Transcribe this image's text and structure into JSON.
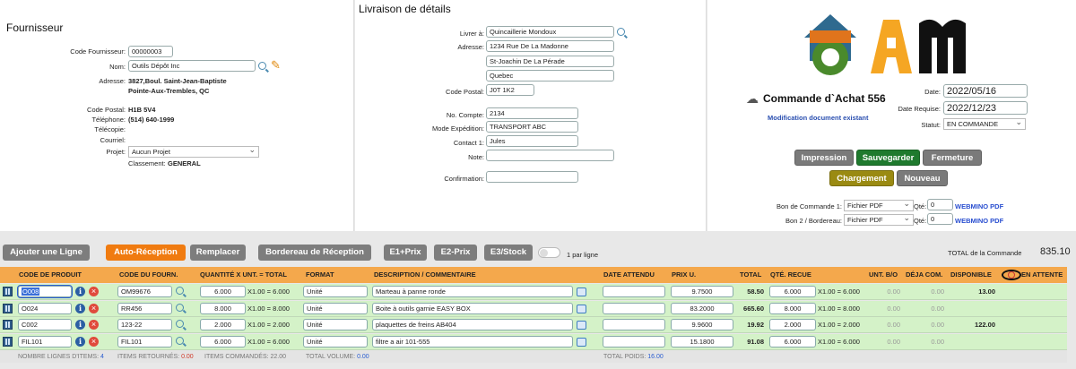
{
  "supplier": {
    "title": "Fournisseur",
    "code_label": "Code Fournisseur:",
    "code": "00000003",
    "name_label": "Nom:",
    "name": "Outils Dépôt Inc",
    "address_label": "Adresse:",
    "address1": "3827,Boul. Saint-Jean-Baptiste",
    "address2": "Pointe-Aux-Trembles, QC",
    "postal_label": "Code Postal:",
    "postal": "H1B 5V4",
    "phone_label": "Téléphone:",
    "phone": "(514) 640-1999",
    "fax_label": "Télécopie:",
    "email_label": "Courriel:",
    "project_label": "Projet:",
    "project": "Aucun Projet",
    "class_label": "Classement:",
    "class": "GENERAL"
  },
  "delivery": {
    "title": "Livraison de détails",
    "deliver_label": "Livrer à:",
    "deliver": "Quincaillerie Mondoux",
    "address_label": "Adresse:",
    "address1": "1234 Rue De La Madonne",
    "address2": "St-Joachin De La Pérade",
    "address3": "Quebec",
    "postal_label": "Code Postal:",
    "postal": "J0T 1K2",
    "account_label": "No. Compte:",
    "account": "2134",
    "ship_label": "Mode Expédition:",
    "ship": "TRANSPORT ABC",
    "contact_label": "Contact 1:",
    "contact": "Jules",
    "note_label": "Note:",
    "note": "",
    "confirm_label": "Confirmation:",
    "confirm": ""
  },
  "order": {
    "title": "Commande d`Achat 556",
    "subtitle": "Modification document existant",
    "date_label": "Date:",
    "date": "2022/05/16",
    "req_label": "Date Requise:",
    "req": "2022/12/23",
    "status_label": "Statut:",
    "status": "EN COMMANDE"
  },
  "actions": {
    "print": "Impression",
    "save": "Sauvegarder",
    "close": "Fermeture",
    "load": "Chargement",
    "new": "Nouveau"
  },
  "docs": {
    "bc1_label": "Bon de Commande 1:",
    "bc1_fmt": "Fichier PDF",
    "bc2_label": "Bon 2 / Bordereau:",
    "bc2_fmt": "Fichier PDF",
    "qty_label": "Qté:",
    "qty1": "0",
    "qty2": "0",
    "link": "WEBMINO PDF"
  },
  "toolbar": {
    "add": "Ajouter une Ligne",
    "auto": "Auto-Réception",
    "replace": "Remplacer",
    "slip": "Bordereau de Réception",
    "e1": "E1+Prix",
    "e2": "E2-Prix",
    "e3": "E3/Stock",
    "toggle_label": "1 par ligne",
    "total_label": "TOTAL de la Commande",
    "total": "835.10"
  },
  "headers": [
    "CODE DE PRODUIT",
    "CODE DU FOURN.",
    "QUANTITÉ X UNT. = TOTAL",
    "FORMAT",
    "DESCRIPTION / COMMENTAIRE",
    "DATE ATTENDU",
    "PRIX U.",
    "TOTAL",
    "QTÉ. RECUE",
    "UNT. B/O",
    "DÉJA COM.",
    "DISPONIBLE",
    "EN ATTENTE"
  ],
  "rows": [
    {
      "code": "O008",
      "fcode": "OM99676",
      "qty": "6.000",
      "calc": "X1.00 = 6.000",
      "fmt": "Unité",
      "desc": "Marteau à panne ronde",
      "date": "",
      "price": "9.7500",
      "total": "58.50",
      "recv": "6.000",
      "rcalc": "X1.00 = 6.000",
      "bo": "0.00",
      "deja": "0.00",
      "dispo": "13.00"
    },
    {
      "code": "O024",
      "fcode": "RR456",
      "qty": "8.000",
      "calc": "X1.00 = 8.000",
      "fmt": "Unité",
      "desc": "Boite à outils garnie EASY BOX",
      "date": "",
      "price": "83.2000",
      "total": "665.60",
      "recv": "8.000",
      "rcalc": "X1.00 = 8.000",
      "bo": "0.00",
      "deja": "0.00",
      "dispo": ""
    },
    {
      "code": "C002",
      "fcode": "123-22",
      "qty": "2.000",
      "calc": "X1.00 = 2.000",
      "fmt": "Unité",
      "desc": "plaquettes de freins AB404",
      "date": "",
      "price": "9.9600",
      "total": "19.92",
      "recv": "2.000",
      "rcalc": "X1.00 = 2.000",
      "bo": "0.00",
      "deja": "0.00",
      "dispo": "122.00"
    },
    {
      "code": "FIL101",
      "fcode": "FIL101",
      "qty": "6.000",
      "calc": "X1.00 = 6.000",
      "fmt": "Unité",
      "desc": "filtre a air 101-555",
      "date": "",
      "price": "15.1800",
      "total": "91.08",
      "recv": "6.000",
      "rcalc": "X1.00 = 6.000",
      "bo": "0.00",
      "deja": "0.00",
      "dispo": ""
    }
  ],
  "footer": {
    "lines_label": "NOMBRE LIGNES D'ITEMS:",
    "lines": "4",
    "ret_label": "ITEMS RETOURNÉS:",
    "ret": "0.00",
    "cmd_label": "ITEMS COMMANDÉS:",
    "cmd": "22.00",
    "vol_label": "TOTAL VOLUME:",
    "vol": "0.00",
    "wt_label": "TOTAL POIDS:",
    "wt": "16.00"
  },
  "colors": {
    "orange": "#f07b10",
    "header": "#f4a84c",
    "row": "#d4f2c8",
    "green": "#1f7a2e",
    "olive": "#9a8a12"
  }
}
